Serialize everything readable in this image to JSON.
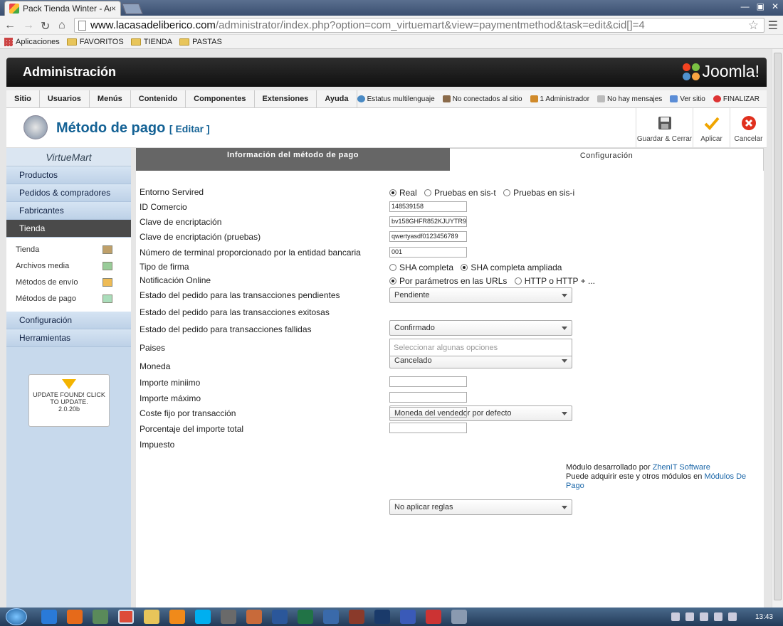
{
  "browser": {
    "tab_title": "Pack Tienda Winter - Adm",
    "tab_close": "×",
    "url_host": "www.lacasadeliberico.com",
    "url_path": "/administrator/index.php?option=com_virtuemart&view=paymentmethod&task=edit&cid[]=4",
    "bookmarks": [
      "Aplicaciones",
      "FAVORITOS",
      "TIENDA",
      "PASTAS"
    ]
  },
  "header": {
    "title": "Administración",
    "brand": "Joomla!"
  },
  "menu": {
    "items": [
      "Sitio",
      "Usuarios",
      "Menús",
      "Contenido",
      "Componentes",
      "Extensiones",
      "Ayuda"
    ],
    "status": [
      "Estatus multilenguaje",
      "No conectados al sitio",
      "1 Administrador",
      "No hay mensajes",
      "Ver sitio",
      "FINALIZAR"
    ]
  },
  "toolbar": {
    "title": "Método de pago",
    "edit": "[ Editar ]",
    "save_close": "Guardar & Cerrar",
    "apply": "Aplicar",
    "cancel": "Cancelar"
  },
  "sidebar": {
    "logo": "VirtueMart",
    "top_items": [
      "Productos",
      "Pedidos & compradores",
      "Fabricantes",
      "Tienda"
    ],
    "sub_items": [
      "Tienda",
      "Archivos media",
      "Métodos de envío",
      "Métodos de pago"
    ],
    "bottom_items": [
      "Configuración",
      "Herramientas"
    ],
    "update": "UPDATE FOUND! CLICK TO UPDATE.",
    "version": "2.0.20b"
  },
  "tabs": {
    "info": "Información del método de pago",
    "config": "Configuración"
  },
  "form": {
    "entorno": {
      "label": "Entorno Servired",
      "options": [
        "Real",
        "Pruebas en sis-t",
        "Pruebas en sis-i"
      ]
    },
    "id_comercio": {
      "label": "ID Comercio",
      "value": "148539158"
    },
    "clave": {
      "label": "Clave de encriptación",
      "value": "bv158GHFR852KJUYTR96"
    },
    "clave_pruebas": {
      "label": "Clave de encriptación (pruebas)",
      "value": "qwertyasdf0123456789"
    },
    "terminal": {
      "label": "Número de terminal proporcionado por la entidad bancaria",
      "value": "001"
    },
    "firma": {
      "label": "Tipo de firma",
      "options": [
        "SHA completa",
        "SHA completa ampliada"
      ]
    },
    "notif": {
      "label": "Notificación Online",
      "options": [
        "Por parámetros en las URLs",
        "HTTP o HTTP + ..."
      ]
    },
    "pendientes": {
      "label": "Estado del pedido para las transacciones pendientes",
      "value": "Pendiente"
    },
    "exitosas": {
      "label": "Estado del pedido para las transacciones exitosas",
      "value": "Confirmado"
    },
    "fallidas": {
      "label": "Estado del pedido para transacciones fallidas",
      "value": "Cancelado"
    },
    "paises": {
      "label": "Paises",
      "placeholder": "Seleccionar algunas opciones"
    },
    "moneda": {
      "label": "Moneda",
      "value": "Moneda del vendedor por defecto"
    },
    "minimo": {
      "label": "Importe miniimo"
    },
    "maximo": {
      "label": "Importe máximo"
    },
    "coste": {
      "label": "Coste fijo por transacción"
    },
    "porcentaje": {
      "label": "Porcentaje del importe total"
    },
    "impuesto": {
      "label": "Impuesto",
      "value": "No aplicar reglas"
    }
  },
  "credits": {
    "line1": "Módulo desarrollado por",
    "link1": "ZhenIT Software",
    "line2": "Puede adquirir este y otros módulos en",
    "link2": "Módulos De Pago"
  },
  "taskbar": {
    "clock": "13:43"
  }
}
